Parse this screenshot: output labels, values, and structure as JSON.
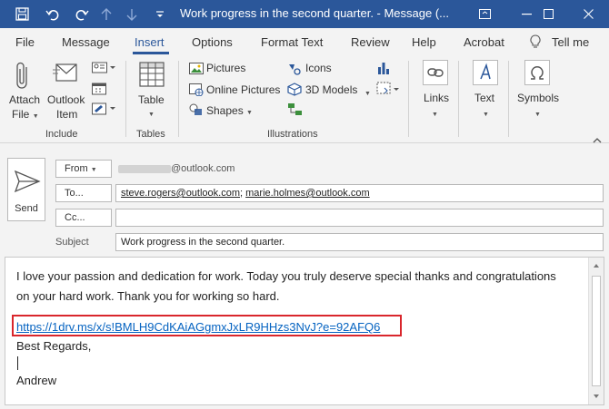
{
  "window": {
    "title": "Work progress in the second quarter.  -  Message (..."
  },
  "tabs": [
    "File",
    "Message",
    "Insert",
    "Options",
    "Format Text",
    "Review",
    "Help",
    "Acrobat",
    "Tell me"
  ],
  "active_tab": "Insert",
  "ribbon": {
    "include": {
      "attach_label": "Attach",
      "attach_sub": "File",
      "outlook_label": "Outlook",
      "outlook_sub": "Item",
      "group": "Include"
    },
    "tables": {
      "table_label": "Table",
      "group": "Tables"
    },
    "illustrations": {
      "pictures": "Pictures",
      "online_pictures": "Online Pictures",
      "shapes": "Shapes",
      "icons": "Icons",
      "models_3d": "3D Models",
      "group": "Illustrations"
    },
    "links": "Links",
    "text": "Text",
    "symbols": "Symbols"
  },
  "header": {
    "send_label": "Send",
    "from_label": "From",
    "from_value": "@outlook.com",
    "to_label": "To...",
    "to_recipients": [
      "steve.rogers@outlook.com",
      "marie.holmes@outlook.com"
    ],
    "cc_label": "Cc...",
    "subject_label": "Subject",
    "subject_value": "Work progress in the second quarter."
  },
  "body": {
    "line1": "I love your passion and dedication for work. Today you truly deserve special thanks and congratulations",
    "line2": "on your hard work. Thank you for working so hard.",
    "link": "https://1drv.ms/x/s!BMLH9CdKAiAGgmxJxLR9HHzs3NvJ?e=92AFQ6",
    "regards": "Best Regards,",
    "signature": "Andrew"
  },
  "colors": {
    "title_bar": "#2b579a",
    "link": "#0563c1",
    "highlight_box": "#d9262c"
  }
}
